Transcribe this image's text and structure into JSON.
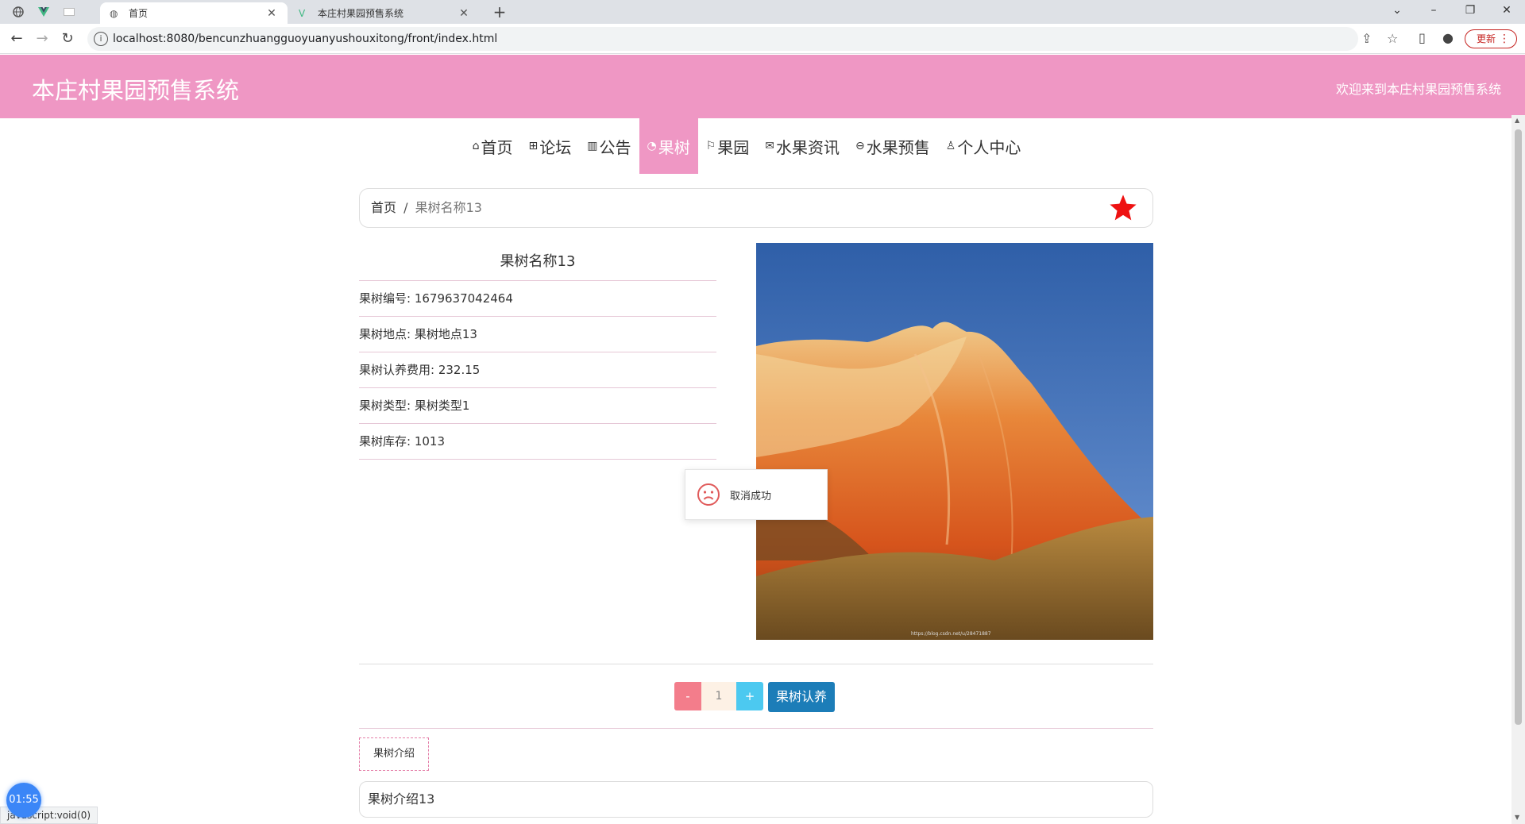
{
  "browser": {
    "tabs": [
      {
        "title": "首页",
        "favicon": "globe-icon",
        "active": true
      },
      {
        "title": "本庄村果园预售系统",
        "favicon": "vue-logo-icon",
        "active": false
      }
    ],
    "pinned": [
      "globe-icon",
      "vue-logo-icon",
      "blank-page-icon"
    ],
    "address": "localhost:8080/bencunzhuangguoyuanyushouxitong/front/index.html",
    "update_label": "更新"
  },
  "site": {
    "title": "本庄村果园预售系统",
    "welcome": "欢迎来到本庄村果园预售系统",
    "header_color": "#ef97c4"
  },
  "nav": [
    {
      "icon": "home-icon",
      "label": "首页",
      "active": false
    },
    {
      "icon": "forum-icon",
      "label": "论坛",
      "active": false
    },
    {
      "icon": "notice-icon",
      "label": "公告",
      "active": false
    },
    {
      "icon": "tree-icon",
      "label": "果树",
      "active": true
    },
    {
      "icon": "flag-icon",
      "label": "果园",
      "active": false
    },
    {
      "icon": "mail-icon",
      "label": "水果资讯",
      "active": false
    },
    {
      "icon": "cart-icon",
      "label": "水果预售",
      "active": false
    },
    {
      "icon": "user-icon",
      "label": "个人中心",
      "active": false
    }
  ],
  "breadcrumb": {
    "home": "首页",
    "separator": "/",
    "current": "果树名称13"
  },
  "detail": {
    "name": "果树名称13",
    "rows": [
      "果树编号: 1679637042464",
      "果树地点: 果树地点13",
      "果树认养费用: 232.15",
      "果树类型: 果树类型1",
      "果树库存: 1013"
    ],
    "image_watermark": "https://blog.csdn.net/u/28471887"
  },
  "toast": {
    "message": "取消成功",
    "icon": "sad-face-icon"
  },
  "quantity": {
    "minus": "-",
    "value": "1",
    "plus": "+"
  },
  "adopt_label": "果树认养",
  "intro": {
    "tab_label": "果树介绍",
    "content": "果树介绍13"
  },
  "status_bar": "javascript:void(0)",
  "timer": "01:55"
}
